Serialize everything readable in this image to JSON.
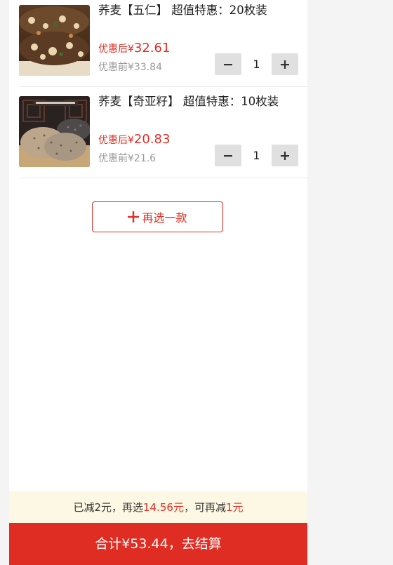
{
  "items": [
    {
      "title": "荞麦【五仁】 超值特惠：20枚装",
      "price_after_label": "优惠后¥",
      "price_after": "32.61",
      "price_before": "优惠前¥33.84",
      "quantity": "1",
      "image": "walnut-pastry-image"
    },
    {
      "title": "荞麦【奇亚籽】 超值特惠：10枚装",
      "price_after_label": "优惠后¥",
      "price_after": "20.83",
      "price_before": "优惠前¥21.6",
      "quantity": "1",
      "image": "chia-pastry-image"
    }
  ],
  "add_more": {
    "icon": "plus-icon",
    "label": "再选一款"
  },
  "promo": {
    "part1": "已减2元，再选",
    "amount": "14.56元",
    "part2": "，可再减",
    "discount": "1元"
  },
  "checkout": {
    "label": "合计¥53.44，去结算"
  },
  "colors": {
    "accent": "#e02d23",
    "promo_bg": "#fdf8e4",
    "stepper_bg": "#e0e0e0"
  }
}
